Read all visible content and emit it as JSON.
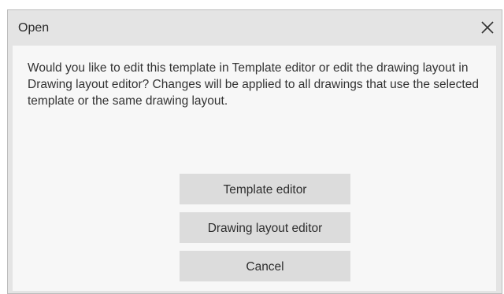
{
  "dialog": {
    "title": "Open",
    "close_icon": "close-icon",
    "message": "Would you like to edit this template in Template editor or edit the drawing layout in Drawing layout editor? Changes will be applied to all drawings that use the selected template or the same drawing layout.",
    "buttons": {
      "template_editor": "Template editor",
      "drawing_layout_editor": "Drawing layout editor",
      "cancel": "Cancel"
    }
  },
  "colors": {
    "dialog_background": "#e4e4e4",
    "content_background": "#f7f7f7",
    "button_background": "#dcdcdc",
    "text": "#333333"
  }
}
